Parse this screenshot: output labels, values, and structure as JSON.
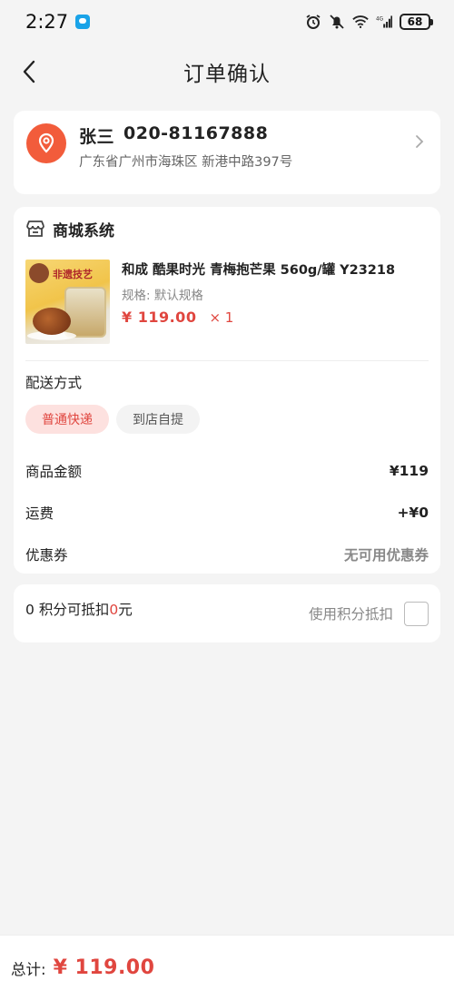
{
  "status_bar": {
    "time": "2:27",
    "battery": "68"
  },
  "nav": {
    "title": "订单确认"
  },
  "address": {
    "name": "张三",
    "phone": "020-81167888",
    "detail": "广东省广州市海珠区 新港中路397号"
  },
  "store": {
    "name": "商城系统"
  },
  "product": {
    "title": "和成 酷果时光 青梅抱芒果 560g/罐 Y23218",
    "image_banner": "非遗技艺",
    "spec": "规格: 默认规格",
    "price": "¥ 119.00",
    "qty": "× 1"
  },
  "shipping": {
    "label": "配送方式",
    "options": [
      {
        "label": "普通快递",
        "active": true
      },
      {
        "label": "到店自提",
        "active": false
      }
    ]
  },
  "summary": {
    "goods_amount_label": "商品金额",
    "goods_amount_value": "¥119",
    "freight_label": "运费",
    "freight_value": "+¥0",
    "coupon_label": "优惠券",
    "coupon_value": "无可用优惠券"
  },
  "points": {
    "count": "0",
    "text_middle": "积分可抵扣",
    "deduct": "0",
    "unit": "元",
    "use_label": "使用积分抵扣"
  },
  "footer": {
    "total_label": "总计:",
    "total_value": "¥ 119.00"
  },
  "colors": {
    "accent": "#e0463f",
    "location_icon": "#f25c3b"
  }
}
